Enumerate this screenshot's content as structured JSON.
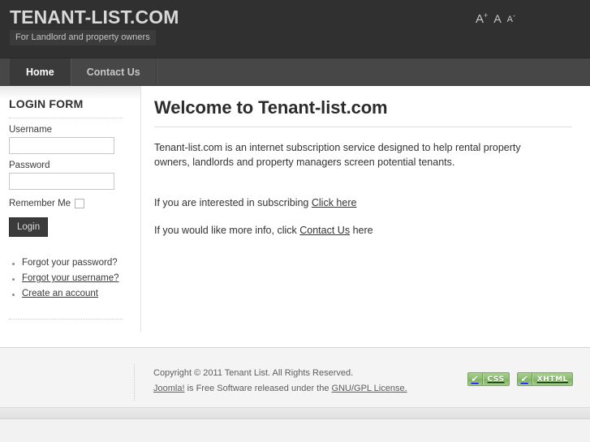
{
  "site": {
    "title": "TENANT-LIST.COM",
    "tagline": "For Landlord and property owners"
  },
  "header": {
    "font_increase": "A",
    "font_increase_sup": "+",
    "font_reset": "A",
    "font_decrease": "A",
    "font_decrease_sup": "-"
  },
  "nav": {
    "items": [
      {
        "label": "Home",
        "active": true
      },
      {
        "label": "Contact Us",
        "active": false
      }
    ]
  },
  "sidebar": {
    "module_title": "LOGIN FORM",
    "username_label": "Username",
    "username_value": "",
    "password_label": "Password",
    "password_value": "",
    "remember_label": "Remember Me",
    "remember_checked": false,
    "login_button": "Login",
    "links": [
      {
        "label": "Forgot your password?",
        "underlined": false
      },
      {
        "label": "Forgot your username?",
        "underlined": true
      },
      {
        "label": "Create an account",
        "underlined": true
      }
    ]
  },
  "content": {
    "heading": "Welcome to Tenant-list.com",
    "intro": "Tenant-list.com is an internet subscription service designed to help rental property owners, landlords and property managers screen potential tenants.",
    "subscribe_prefix": "If you are interested in subscribing ",
    "subscribe_link": "Click here",
    "info_prefix": "If you would like more info, click ",
    "info_link": "Contact Us",
    "info_suffix": " here"
  },
  "footer": {
    "copyright": "Copyright © 2011 Tenant List. All Rights Reserved.",
    "joomla_link": "Joomla!",
    "license_mid": " is Free Software released under the ",
    "license_link": "GNU/GPL License.",
    "badges": [
      {
        "check": "✔",
        "label": "CSS"
      },
      {
        "check": "✔",
        "label": "XHTML"
      }
    ]
  },
  "colors": {
    "header_bg": "#303030",
    "nav_bg": "#474747",
    "nav_active_bg": "#3a3a3a",
    "badge_green": "#8dbd72",
    "page_bg": "#f2f2f2"
  }
}
